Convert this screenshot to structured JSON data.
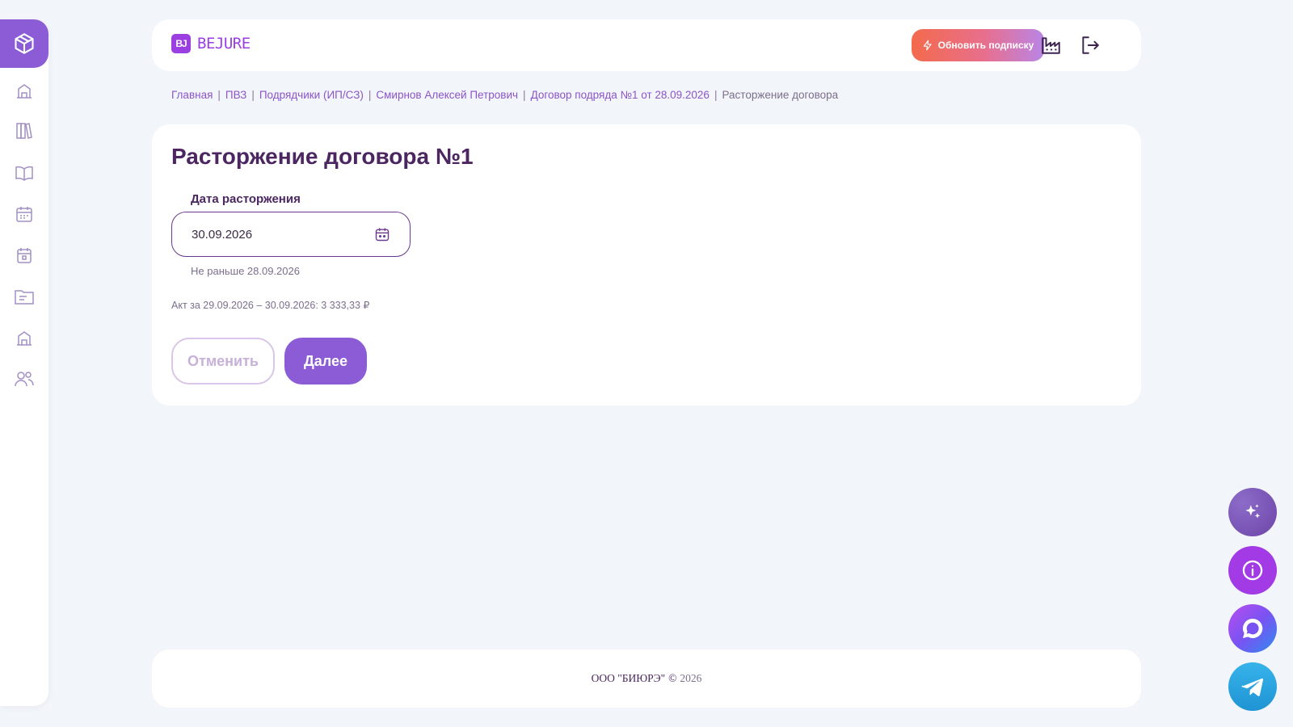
{
  "sidebar": {
    "items": [
      {
        "icon": "box-icon",
        "active": true
      },
      {
        "icon": "building-icon"
      },
      {
        "icon": "books-icon"
      },
      {
        "icon": "book-open-icon"
      },
      {
        "icon": "calendar-grid-icon"
      },
      {
        "icon": "calendar-day-icon"
      },
      {
        "icon": "folder-icon"
      },
      {
        "icon": "building-icon"
      },
      {
        "icon": "users-icon"
      }
    ]
  },
  "header": {
    "logo_mark": "BJ",
    "logo_text": "BEJURE",
    "upgrade_label": "Обновить подписку",
    "icons": [
      "factory-icon",
      "logout-icon"
    ]
  },
  "breadcrumb": {
    "items": [
      "Главная",
      "ПВЗ",
      "Подрядчики (ИП/СЗ)",
      "Смирнов Алексей Петрович",
      "Договор подряда №1 от 28.09.2026"
    ],
    "current": "Расторжение договора",
    "separator": "|"
  },
  "form": {
    "title": "Расторжение договора №1",
    "date_label": "Дата расторжения",
    "date_value": "30.09.2026",
    "hint": "Не раньше 28.09.2026",
    "act_info": "Акт за 29.09.2026 – 30.09.2026: 3 333,33 ₽",
    "cancel_label": "Отменить",
    "next_label": "Далее"
  },
  "footer": {
    "company": "ООО \"БИЮРЭ\"",
    "copyright": "©",
    "year": "2026"
  },
  "fabs": [
    "sparkles-icon",
    "info-icon",
    "chat-icon",
    "telegram-icon"
  ],
  "colors": {
    "accent": "#8b5cd6",
    "brand": "#9b3fe3",
    "text_dark": "#4b2660",
    "muted": "#7c6f8c",
    "link": "#8b55c9",
    "background": "#f2f5f9"
  }
}
